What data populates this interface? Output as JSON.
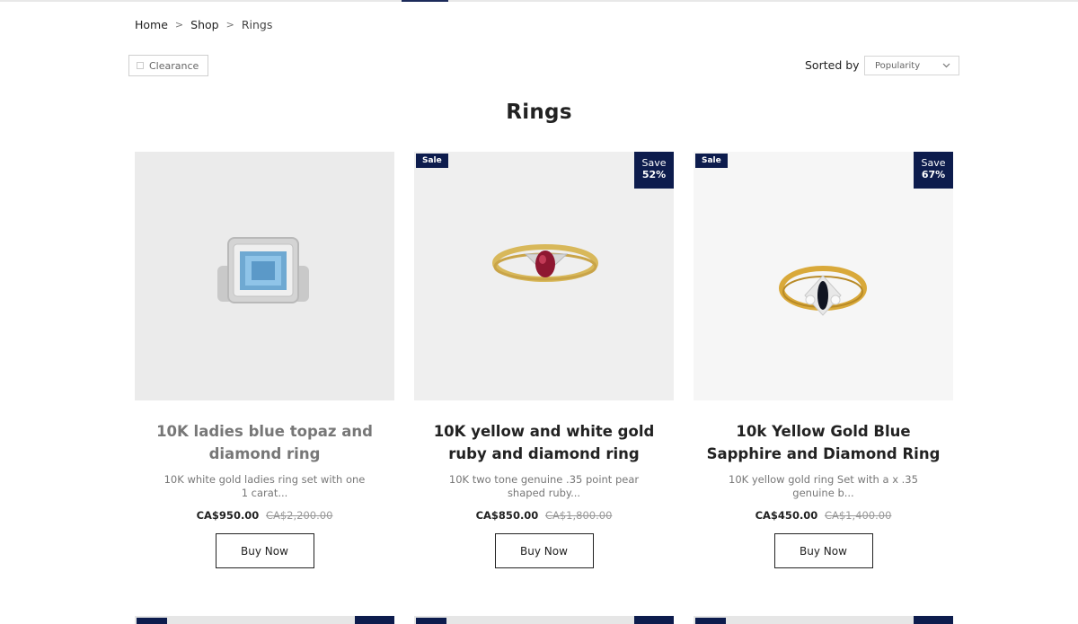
{
  "breadcrumb": {
    "home": "Home",
    "shop": "Shop",
    "current": "Rings",
    "separator": ">"
  },
  "filters": {
    "clearance_label": "Clearance"
  },
  "sort": {
    "label": "Sorted by",
    "selected": "Popularity"
  },
  "page_title": "Rings",
  "colors": {
    "accent": "#0d1c4d"
  },
  "products": [
    {
      "name": "10K ladies blue topaz and diamond ring",
      "description": "10K white gold ladies ring set with one 1 carat...",
      "price": "CA$950.00",
      "old_price": "CA$2,200.00",
      "buy_label": "Buy Now",
      "sale_badge": "",
      "save_label": "",
      "save_pct": ""
    },
    {
      "name": "10K yellow and white gold ruby and diamond ring",
      "description": "10K two tone genuine .35 point pear shaped ruby...",
      "price": "CA$850.00",
      "old_price": "CA$1,800.00",
      "buy_label": "Buy Now",
      "sale_badge": "Sale",
      "save_label": "Save",
      "save_pct": "52%"
    },
    {
      "name": "10k Yellow Gold Blue Sapphire and Diamond Ring",
      "description": "10K yellow gold ring Set with a x .35 genuine b...",
      "price": "CA$450.00",
      "old_price": "CA$1,400.00",
      "buy_label": "Buy Now",
      "sale_badge": "Sale",
      "save_label": "Save",
      "save_pct": "67%"
    }
  ]
}
